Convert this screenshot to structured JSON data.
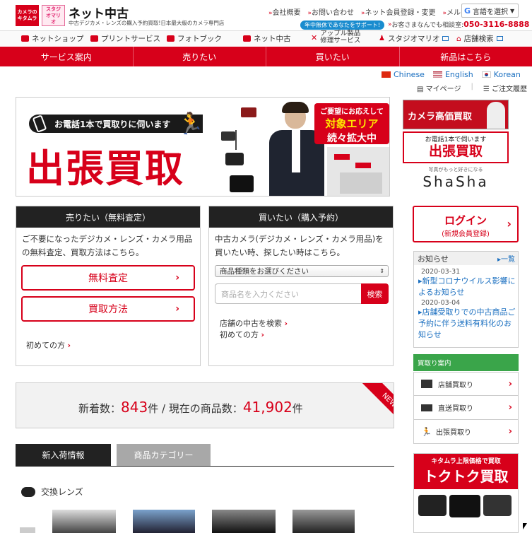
{
  "header": {
    "logo1_text": "カメラのキタムラ",
    "logo2_text": "スタジオマリオ",
    "site_title": "ネット中古",
    "site_subtitle": "中古デジカメ・レンズの購入予約買取!日本最大級のカメラ専門店",
    "links": [
      "会社概要",
      "お問い合わせ",
      "ネット会員登録・変更",
      "メルマガ登録"
    ],
    "translate_label": "言語を選択",
    "support_badge": "年中無休であなたをサポート!",
    "support_text": "お客さまなんでも相談室:",
    "phone": "050-3116-8888"
  },
  "toolbar": [
    {
      "label": "ネットショップ"
    },
    {
      "label": "プリントサービス"
    },
    {
      "label": "フォトブック"
    },
    {
      "label": "ネット中古"
    },
    {
      "label": "アップル製品\n修理サービス"
    },
    {
      "label": "スタジオマリオ"
    },
    {
      "label": "店舗検索"
    }
  ],
  "mainnav": [
    "サービス案内",
    "売りたい",
    "買いたい",
    "新品はこちら"
  ],
  "languages": [
    "Chinese",
    "English",
    "Korean"
  ],
  "account": {
    "mypage": "マイページ",
    "history": "ご注文履歴"
  },
  "banner": {
    "tagline": "お電話1本で買取りに伺います",
    "headline": "出張買取",
    "bubble_line1": "ご要望にお応えして",
    "bubble_line2": "対象エリア",
    "bubble_line3": "続々拡大中"
  },
  "side_banners": {
    "kaitori": "カメラ高価買取",
    "shutcho_small": "お電話1本で伺います",
    "shutcho": "出張買取",
    "shasha_small": "写真がもっと好きになる",
    "shasha": "ShaSha"
  },
  "sell_panel": {
    "title": "売りたい（無料査定）",
    "desc": "ご不要になったデジカメ・レンズ・カメラ用品の無料査定、買取方法はこちら。",
    "btn_assess": "無料査定",
    "btn_method": "買取方法",
    "first_time": "初めての方"
  },
  "buy_panel": {
    "title": "買いたい（購入予約）",
    "desc": "中古カメラ(デジカメ・レンズ・カメラ用品)を買いたい時、探したい時はこちら。",
    "select_value": "商品種類をお選びください",
    "search_placeholder": "商品名を入力ください",
    "search_button": "検索",
    "store_search": "店舗の中古を検索",
    "first_time": "初めての方"
  },
  "login": {
    "title": "ログイン",
    "sub": "(新規会員登録)"
  },
  "news": {
    "title": "お知らせ",
    "list_link": "一覧",
    "items": [
      {
        "date": "2020-03-31",
        "text": "新型コロナウイルス影響によるお知らせ"
      },
      {
        "date": "2020-03-04",
        "text": "店舗受取りでの中古商品ご予約に伴う送料有料化のお知らせ"
      }
    ]
  },
  "kaitori_menu": {
    "title": "買取り案内",
    "items": [
      "店舗買取り",
      "直送買取り",
      "出張買取り"
    ]
  },
  "counter": {
    "new_label": "新着数：",
    "new_count": "843",
    "unit": "件",
    "sep": " / 現在の商品数：",
    "total_count": "41,902",
    "ribbon": "NEW"
  },
  "tabs": [
    "新入荷情報",
    "商品カテゴリー"
  ],
  "section": {
    "title": "交換レンズ"
  },
  "ad": {
    "small": "キタムラ上限価格で買取",
    "big": "トクトク買取"
  },
  "colors": {
    "brand_red": "#d7001a",
    "dark": "#222222",
    "green": "#3aa54a"
  }
}
